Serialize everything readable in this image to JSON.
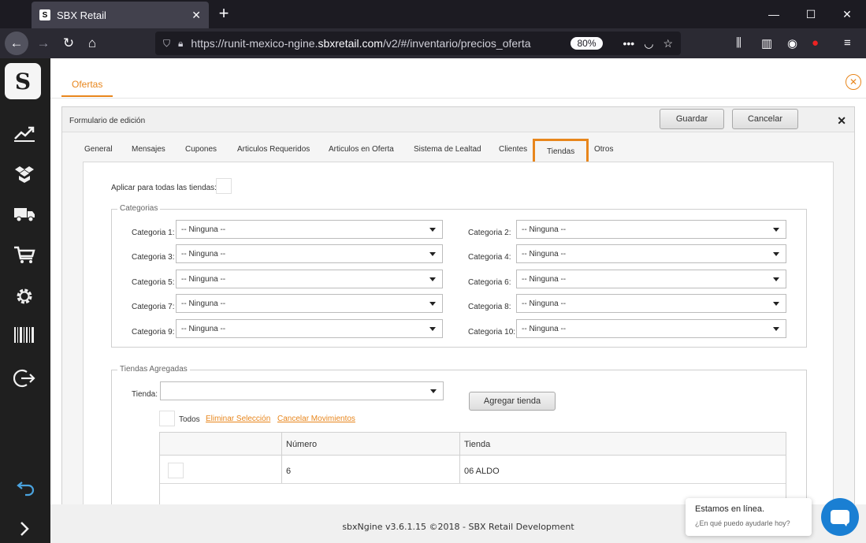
{
  "browser": {
    "tab_title": "SBX Retail",
    "favicon_text": "S",
    "url_prefix": "https://runit-mexico-ngine.",
    "url_domain": "sbxretail.com",
    "url_suffix": "/v2/#/inventario/precios_oferta",
    "zoom": "80%"
  },
  "sidebar": {
    "logo_text": "S"
  },
  "page": {
    "tab_label": "Ofertas"
  },
  "form": {
    "title": "Formulario de edición",
    "save_label": "Guardar",
    "cancel_label": "Cancelar",
    "tabs": [
      "General",
      "Mensajes",
      "Cupones",
      "Articulos Requeridos",
      "Articulos en Oferta",
      "Sistema de Lealtad",
      "Clientes",
      "Tiendas",
      "Otros"
    ],
    "active_tab": "Tiendas",
    "apply_all_label": "Aplicar para todas las tiendas:",
    "categories": {
      "legend": "Categorias",
      "items": [
        {
          "label": "Categoria 1:",
          "value": "-- Ninguna --"
        },
        {
          "label": "Categoria 2:",
          "value": "-- Ninguna --"
        },
        {
          "label": "Categoria 3:",
          "value": "-- Ninguna --"
        },
        {
          "label": "Categoria 4:",
          "value": "-- Ninguna --"
        },
        {
          "label": "Categoria 5:",
          "value": "-- Ninguna --"
        },
        {
          "label": "Categoria 6:",
          "value": "-- Ninguna --"
        },
        {
          "label": "Categoria 7:",
          "value": "-- Ninguna --"
        },
        {
          "label": "Categoria 8:",
          "value": "-- Ninguna --"
        },
        {
          "label": "Categoria 9:",
          "value": "-- Ninguna --"
        },
        {
          "label": "Categoria 10:",
          "value": "-- Ninguna --"
        }
      ]
    },
    "stores": {
      "legend": "Tiendas Agregadas",
      "store_label": "Tienda:",
      "store_value": "",
      "add_button": "Agregar tienda",
      "all_label": "Todos",
      "remove_selection": "Eliminar Selección",
      "cancel_moves": "Cancelar Movimientos",
      "columns": [
        "Número",
        "Tienda"
      ],
      "rows": [
        {
          "numero": "6",
          "tienda": "06 ALDO"
        }
      ]
    }
  },
  "footer": {
    "text": "sbxNgine v3.6.1.15 ©2018 - SBX Retail Development"
  },
  "chat": {
    "title": "Estamos en línea.",
    "subtitle": "¿En qué puedo ayudarle hoy?"
  },
  "colors": {
    "accent": "#e8861c",
    "chat": "#1a7fd3"
  }
}
